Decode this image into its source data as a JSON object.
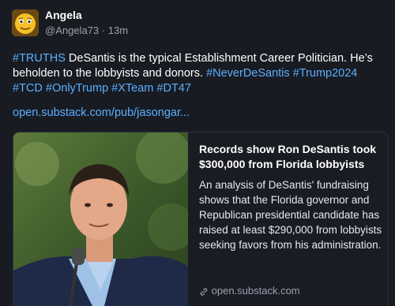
{
  "author": {
    "name": "Angela",
    "handle": "@Angela73",
    "separator": "·",
    "time": "13m"
  },
  "post": {
    "tag_truths": "#TRUTHS",
    "body": " DeSantis is the typical Establishment Career Politician. He’s beholden to the lobbyists and donors. ",
    "tag_never": "#NeverDeSantis",
    "tag_trump": "#Trump2024",
    "tag_tcd": "#TCD",
    "tag_only": "#OnlyTrump",
    "tag_xteam": "#XTeam",
    "tag_dt47": "#DT47",
    "link_text": "open.substack.com/pub/jasongar..."
  },
  "card": {
    "title": "Records show Ron DeSantis took $300,000 from Florida lobbyists",
    "description": "An analysis of DeSantis' fundraising shows that the Florida governor and Republican presidential candidate has raised at least $290,000 from lobbyists seeking favors from his administration.",
    "domain": "open.substack.com",
    "link_icon": "link-icon"
  },
  "colors": {
    "background": "#191b22",
    "hashtag": "#59b0ff",
    "muted": "#9ba1b3",
    "avatar": "#f4b41a"
  }
}
